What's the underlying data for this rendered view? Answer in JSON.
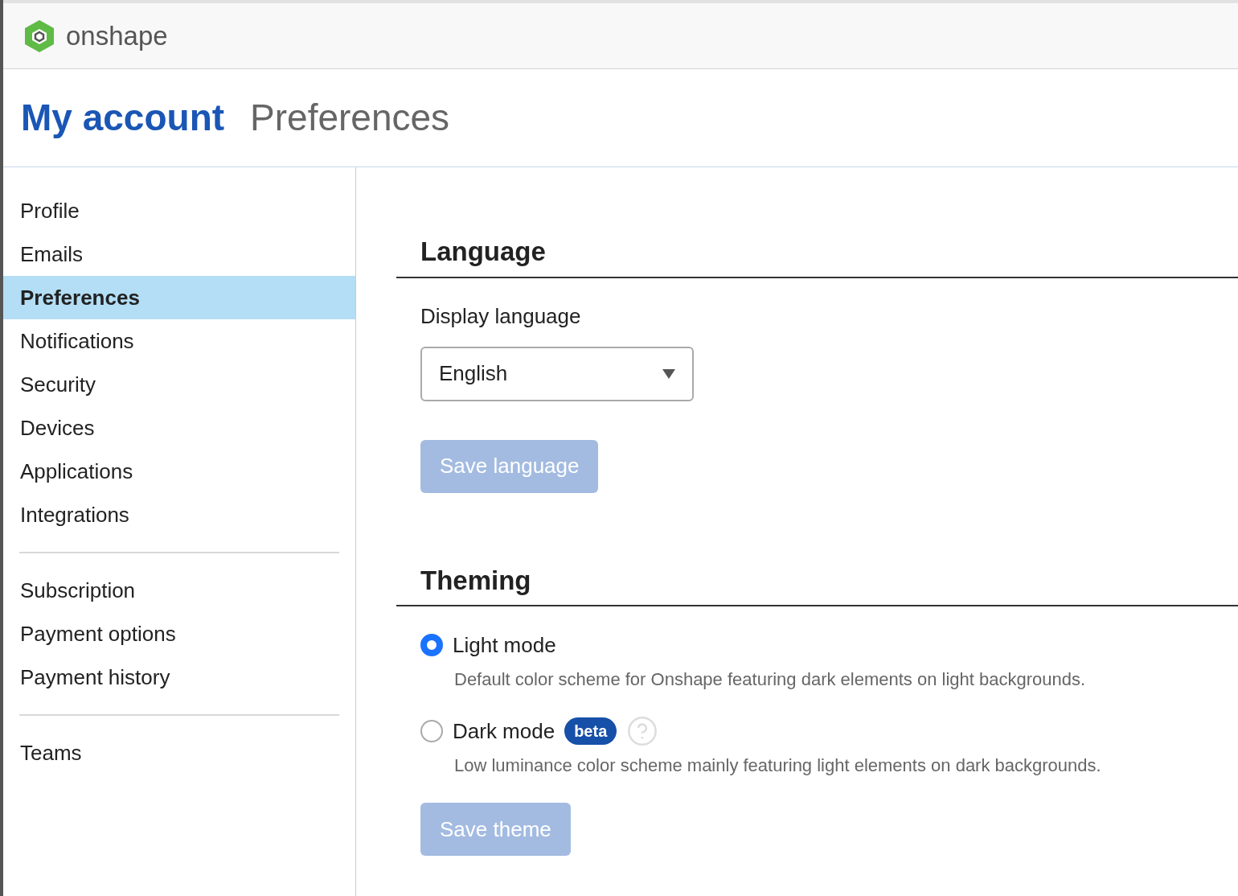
{
  "app": {
    "name": "onshape"
  },
  "header": {
    "title": "My account",
    "subtitle": "Preferences"
  },
  "sidebar": {
    "groups": [
      {
        "items": [
          {
            "label": "Profile",
            "selected": false
          },
          {
            "label": "Emails",
            "selected": false
          },
          {
            "label": "Preferences",
            "selected": true
          },
          {
            "label": "Notifications",
            "selected": false
          },
          {
            "label": "Security",
            "selected": false
          },
          {
            "label": "Devices",
            "selected": false
          },
          {
            "label": "Applications",
            "selected": false
          },
          {
            "label": "Integrations",
            "selected": false
          }
        ]
      },
      {
        "items": [
          {
            "label": "Subscription",
            "selected": false
          },
          {
            "label": "Payment options",
            "selected": false
          },
          {
            "label": "Payment history",
            "selected": false
          }
        ]
      },
      {
        "items": [
          {
            "label": "Teams",
            "selected": false
          }
        ]
      }
    ]
  },
  "language": {
    "heading": "Language",
    "label": "Display language",
    "value": "English",
    "button": {
      "label": "Save language",
      "disabled": true
    }
  },
  "theming": {
    "heading": "Theming",
    "options": [
      {
        "label": "Light mode",
        "selected": true,
        "description": "Default color scheme for Onshape featuring dark elements on light backgrounds."
      },
      {
        "label": "Dark mode",
        "selected": false,
        "badge": "beta",
        "help": true,
        "description": "Low luminance color scheme mainly featuring light elements on dark backgrounds."
      }
    ],
    "button": {
      "label": "Save theme",
      "disabled": true
    }
  }
}
